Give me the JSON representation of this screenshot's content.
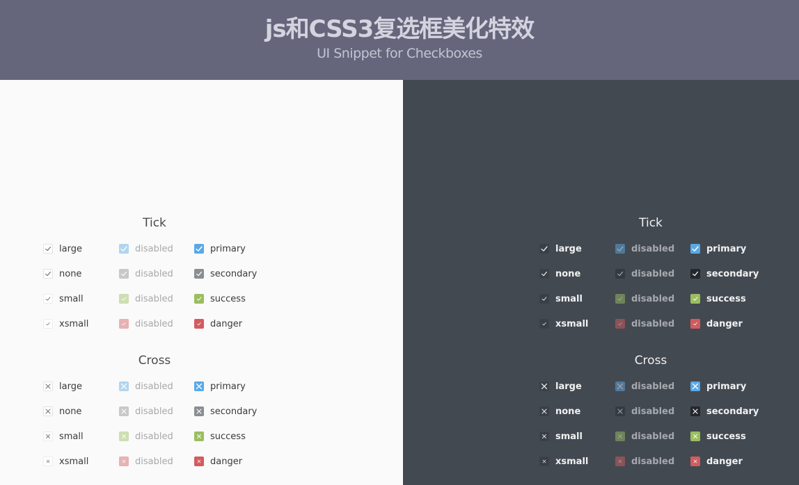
{
  "header": {
    "title": "js和CSS3复选框美化特效",
    "subtitle": "UI Snippet for Checkboxes"
  },
  "theme": {
    "header_bg": "#65667b",
    "light_bg": "#fafafa",
    "dark_bg": "#434951",
    "primary": "#5aa9e6",
    "secondary": "#8a8d92",
    "success": "#9bbe5f",
    "danger": "#d35b5f"
  },
  "panels": [
    {
      "theme": "light",
      "groups": [
        {
          "title": "Tick",
          "mark": "tick",
          "rows": [
            {
              "size": "large",
              "cells": [
                {
                  "label": "large",
                  "variant": "default",
                  "checked": true,
                  "disabled": false
                },
                {
                  "label": "disabled",
                  "variant": "primary",
                  "checked": true,
                  "disabled": true
                },
                {
                  "label": "primary",
                  "variant": "primary",
                  "checked": true,
                  "disabled": false
                }
              ]
            },
            {
              "size": "none",
              "cells": [
                {
                  "label": "none",
                  "variant": "default",
                  "checked": true,
                  "disabled": false
                },
                {
                  "label": "disabled",
                  "variant": "secondary",
                  "checked": true,
                  "disabled": true
                },
                {
                  "label": "secondary",
                  "variant": "secondary",
                  "checked": true,
                  "disabled": false
                }
              ]
            },
            {
              "size": "small",
              "cells": [
                {
                  "label": "small",
                  "variant": "default",
                  "checked": true,
                  "disabled": false
                },
                {
                  "label": "disabled",
                  "variant": "success",
                  "checked": true,
                  "disabled": true
                },
                {
                  "label": "success",
                  "variant": "success",
                  "checked": true,
                  "disabled": false
                }
              ]
            },
            {
              "size": "xsmall",
              "cells": [
                {
                  "label": "xsmall",
                  "variant": "default",
                  "checked": true,
                  "disabled": false
                },
                {
                  "label": "disabled",
                  "variant": "danger",
                  "checked": true,
                  "disabled": true
                },
                {
                  "label": "danger",
                  "variant": "danger",
                  "checked": true,
                  "disabled": false
                }
              ]
            }
          ]
        },
        {
          "title": "Cross",
          "mark": "cross",
          "rows": [
            {
              "size": "large",
              "cells": [
                {
                  "label": "large",
                  "variant": "default",
                  "checked": true,
                  "disabled": false
                },
                {
                  "label": "disabled",
                  "variant": "primary",
                  "checked": true,
                  "disabled": true
                },
                {
                  "label": "primary",
                  "variant": "primary",
                  "checked": true,
                  "disabled": false
                }
              ]
            },
            {
              "size": "none",
              "cells": [
                {
                  "label": "none",
                  "variant": "default",
                  "checked": true,
                  "disabled": false
                },
                {
                  "label": "disabled",
                  "variant": "secondary",
                  "checked": true,
                  "disabled": true
                },
                {
                  "label": "secondary",
                  "variant": "secondary",
                  "checked": true,
                  "disabled": false
                }
              ]
            },
            {
              "size": "small",
              "cells": [
                {
                  "label": "small",
                  "variant": "default",
                  "checked": true,
                  "disabled": false
                },
                {
                  "label": "disabled",
                  "variant": "success",
                  "checked": true,
                  "disabled": true
                },
                {
                  "label": "success",
                  "variant": "success",
                  "checked": true,
                  "disabled": false
                }
              ]
            },
            {
              "size": "xsmall",
              "cells": [
                {
                  "label": "xsmall",
                  "variant": "default",
                  "checked": true,
                  "disabled": false
                },
                {
                  "label": "disabled",
                  "variant": "danger",
                  "checked": true,
                  "disabled": true
                },
                {
                  "label": "danger",
                  "variant": "danger",
                  "checked": true,
                  "disabled": false
                }
              ]
            }
          ]
        }
      ]
    },
    {
      "theme": "dark",
      "groups": [
        {
          "title": "Tick",
          "mark": "tick",
          "rows": [
            {
              "size": "large",
              "cells": [
                {
                  "label": "large",
                  "variant": "default",
                  "checked": true,
                  "disabled": false
                },
                {
                  "label": "disabled",
                  "variant": "primary",
                  "checked": true,
                  "disabled": true
                },
                {
                  "label": "primary",
                  "variant": "primary",
                  "checked": true,
                  "disabled": false
                }
              ]
            },
            {
              "size": "none",
              "cells": [
                {
                  "label": "none",
                  "variant": "default",
                  "checked": true,
                  "disabled": false
                },
                {
                  "label": "disabled",
                  "variant": "secondary",
                  "checked": true,
                  "disabled": true
                },
                {
                  "label": "secondary",
                  "variant": "secondary",
                  "checked": true,
                  "disabled": false
                }
              ]
            },
            {
              "size": "small",
              "cells": [
                {
                  "label": "small",
                  "variant": "default",
                  "checked": true,
                  "disabled": false
                },
                {
                  "label": "disabled",
                  "variant": "success",
                  "checked": true,
                  "disabled": true
                },
                {
                  "label": "success",
                  "variant": "success",
                  "checked": true,
                  "disabled": false
                }
              ]
            },
            {
              "size": "xsmall",
              "cells": [
                {
                  "label": "xsmall",
                  "variant": "default",
                  "checked": true,
                  "disabled": false
                },
                {
                  "label": "disabled",
                  "variant": "danger",
                  "checked": true,
                  "disabled": true
                },
                {
                  "label": "danger",
                  "variant": "danger",
                  "checked": true,
                  "disabled": false
                }
              ]
            }
          ]
        },
        {
          "title": "Cross",
          "mark": "cross",
          "rows": [
            {
              "size": "large",
              "cells": [
                {
                  "label": "large",
                  "variant": "default",
                  "checked": true,
                  "disabled": false
                },
                {
                  "label": "disabled",
                  "variant": "primary",
                  "checked": true,
                  "disabled": true
                },
                {
                  "label": "primary",
                  "variant": "primary",
                  "checked": true,
                  "disabled": false
                }
              ]
            },
            {
              "size": "none",
              "cells": [
                {
                  "label": "none",
                  "variant": "default",
                  "checked": true,
                  "disabled": false
                },
                {
                  "label": "disabled",
                  "variant": "secondary",
                  "checked": true,
                  "disabled": true
                },
                {
                  "label": "secondary",
                  "variant": "secondary",
                  "checked": true,
                  "disabled": false
                }
              ]
            },
            {
              "size": "small",
              "cells": [
                {
                  "label": "small",
                  "variant": "default",
                  "checked": true,
                  "disabled": false
                },
                {
                  "label": "disabled",
                  "variant": "success",
                  "checked": true,
                  "disabled": true
                },
                {
                  "label": "success",
                  "variant": "success",
                  "checked": true,
                  "disabled": false
                }
              ]
            },
            {
              "size": "xsmall",
              "cells": [
                {
                  "label": "xsmall",
                  "variant": "default",
                  "checked": true,
                  "disabled": false
                },
                {
                  "label": "disabled",
                  "variant": "danger",
                  "checked": true,
                  "disabled": true
                },
                {
                  "label": "danger",
                  "variant": "danger",
                  "checked": true,
                  "disabled": false
                }
              ]
            }
          ]
        }
      ]
    }
  ]
}
